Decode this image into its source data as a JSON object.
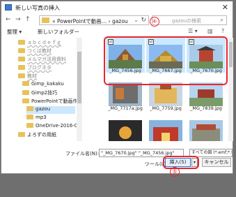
{
  "window": {
    "title": "新しい写真の挿入",
    "close": "✕"
  },
  "nav": {
    "back": "←",
    "forward": "→",
    "up": "↑",
    "address": "« PowerPointで動画… › gazou",
    "address_caret": "⌄",
    "refresh": "↻",
    "search_placeholder": "gazouの検索",
    "search_icon": "⌕"
  },
  "toolbar": {
    "organize": "整理 ▾",
    "new_folder": "新しいフォルダー",
    "view_icon": "☰ ▾",
    "pane_icon": "▥",
    "help_icon": "?"
  },
  "sidebar": {
    "items": [
      {
        "label": "ａｂｃｄｅｆｇ",
        "blur": true
      },
      {
        "label": "つくば教材",
        "blur": true
      },
      {
        "label": "メルマガ活用資料",
        "blur": true
      },
      {
        "label": "ブログネタ",
        "blur": true
      },
      {
        "label": "教材",
        "blur": true
      },
      {
        "label": "Gimp_kakaku",
        "blur": false
      },
      {
        "label": "Gimp2技巧",
        "blur": false
      },
      {
        "label": "PowerPointで動画作成",
        "blur": false
      },
      {
        "label": "gazou",
        "blur": false,
        "selected": true
      },
      {
        "label": "mp3",
        "blur": false
      },
      {
        "label": "OneDrive-2016-02-23",
        "blur": false
      },
      {
        "label": "よろずの用紙",
        "blur": false
      },
      {
        "label": "パソコン表示",
        "blur": true
      }
    ]
  },
  "files": [
    {
      "name": "_MG_7456.jpg",
      "checked": "☑",
      "selected": true
    },
    {
      "name": "_MG_7667.jpg",
      "checked": "☑",
      "selected": true
    },
    {
      "name": "_MG_7670.jpg",
      "checked": "☑",
      "selected": true
    },
    {
      "name": "_MG_7717a.jpg",
      "checked": "",
      "selected": false
    },
    {
      "name": "_MG_7759.jpg",
      "checked": "",
      "selected": false
    },
    {
      "name": "_MG_7839.jpg",
      "checked": "",
      "selected": false
    },
    {
      "name": "",
      "checked": "",
      "selected": false
    },
    {
      "name": "",
      "checked": "",
      "selected": false
    },
    {
      "name": "",
      "checked": "",
      "selected": false
    }
  ],
  "annotations": {
    "four": "④",
    "five": "⑤"
  },
  "footer": {
    "filename_label": "ファイル名(N):",
    "filename_value": "\"_MG_7670.jpg\" \"_MG_7456.jpg\"",
    "filetype": "すべての図 (*.emf;*.wmf;*.jpg;*.j",
    "tool": "ツール(L) ▾",
    "insert": "挿入(S)",
    "insert_arrow": "▾",
    "cancel": "キャンセル"
  },
  "colors": {
    "accent_red": "#e8262d",
    "selection": "#cce8ff",
    "folder": "#e8c15b"
  }
}
